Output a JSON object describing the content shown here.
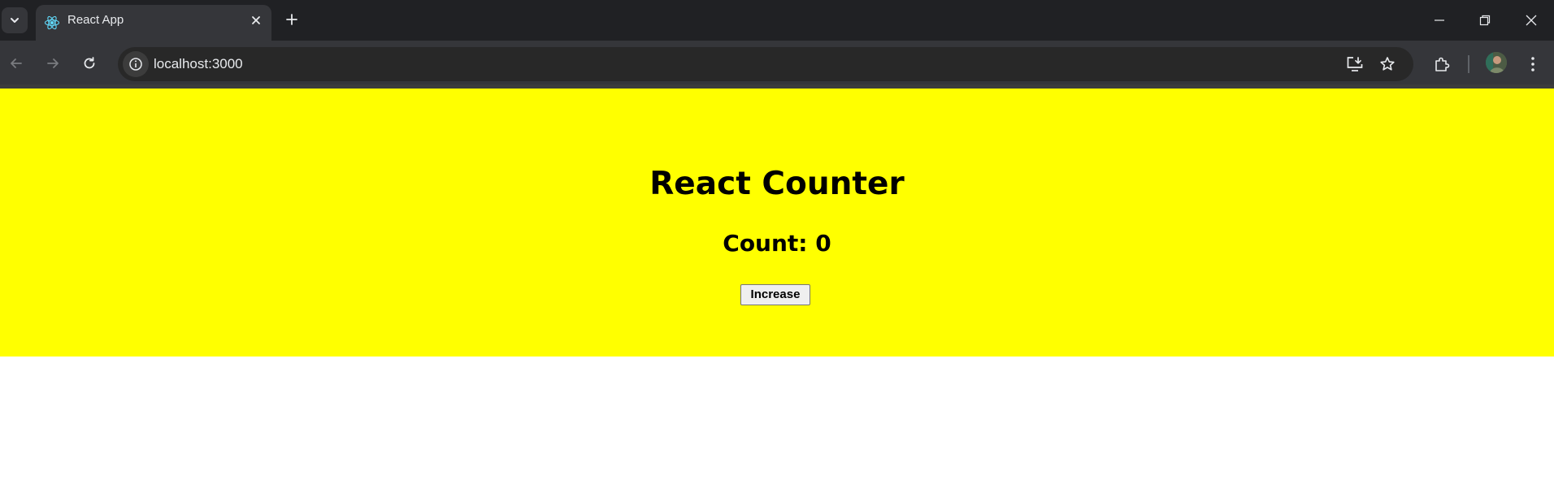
{
  "browser": {
    "tab": {
      "title": "React App",
      "favicon": "react-logo-icon"
    },
    "address_bar": {
      "url": "localhost:3000"
    },
    "icons": {
      "tab_search": "chevron-down-icon",
      "tab_close": "close-icon",
      "new_tab": "plus-icon",
      "minimize": "minimize-icon",
      "restore": "restore-icon",
      "close": "close-icon",
      "back": "arrow-left-icon",
      "forward": "arrow-right-icon",
      "reload": "reload-icon",
      "site_info": "info-icon",
      "install_app": "install-app-icon",
      "bookmark": "star-icon",
      "extensions": "puzzle-icon",
      "menu": "kebab-menu-icon"
    }
  },
  "app": {
    "title": "React Counter",
    "count_label": "Count: ",
    "count_value": "0",
    "increase_label": "Increase",
    "background": "#ffff00"
  }
}
